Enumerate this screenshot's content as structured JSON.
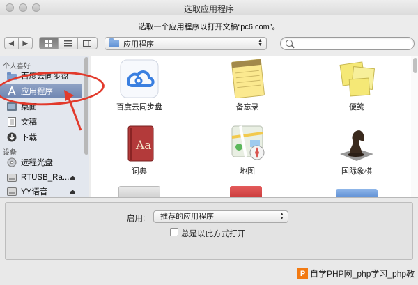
{
  "window": {
    "title": "选取应用程序"
  },
  "prompt": "选取一个应用程序以打开文稿“pc6.com”。",
  "toolbar": {
    "location": "应用程序",
    "search_placeholder": ""
  },
  "sidebar": {
    "favorites_heading": "个人喜好",
    "favorites": [
      {
        "label": "百度云同步盘",
        "icon": "folder-icon"
      },
      {
        "label": "应用程序",
        "icon": "applications-icon",
        "selected": true
      },
      {
        "label": "桌面",
        "icon": "desktop-icon"
      },
      {
        "label": "文稿",
        "icon": "documents-icon"
      },
      {
        "label": "下载",
        "icon": "downloads-icon"
      }
    ],
    "devices_heading": "设备",
    "devices": [
      {
        "label": "远程光盘",
        "icon": "disc-icon"
      },
      {
        "label": "RTUSB_Ra...",
        "icon": "drive-icon",
        "eject": "⏏"
      },
      {
        "label": "YY语音",
        "icon": "drive-icon",
        "eject": "⏏"
      }
    ]
  },
  "apps": [
    {
      "label": "百度云同步盘",
      "icon": "baidu-cloud-icon"
    },
    {
      "label": "备忘录",
      "icon": "notes-icon"
    },
    {
      "label": "便笺",
      "icon": "stickies-icon"
    },
    {
      "label": "词典",
      "icon": "dictionary-icon"
    },
    {
      "label": "地图",
      "icon": "maps-icon"
    },
    {
      "label": "国际象棋",
      "icon": "chess-icon"
    }
  ],
  "bottom": {
    "enable_label": "启用:",
    "enable_value": "推荐的应用程序",
    "always_open_label": "总是以此方式打开"
  },
  "watermark": {
    "logo": "P",
    "text": "自学PHP网_php学习_php教"
  },
  "colors": {
    "annotation": "#e23a2c",
    "selection": "#7a8fb8"
  }
}
